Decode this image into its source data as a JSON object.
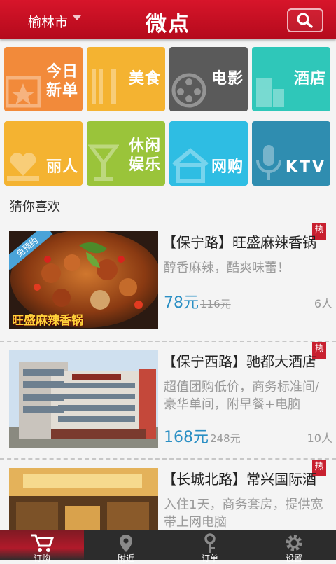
{
  "header": {
    "city": "榆林市",
    "title": "微点"
  },
  "tiles": [
    {
      "label_line1": "今日",
      "label_line2": "新单",
      "color": "#f28a3a",
      "icon": "star-icon"
    },
    {
      "label_line1": "美食",
      "label_line2": "",
      "color": "#f4b331",
      "icon": "fork-knife-icon"
    },
    {
      "label_line1": "电影",
      "label_line2": "",
      "color": "#5a5a5a",
      "icon": "film-reel-icon"
    },
    {
      "label_line1": "酒店",
      "label_line2": "",
      "color": "#2fc7b9",
      "icon": "building-icon"
    },
    {
      "label_line1": "丽人",
      "label_line2": "",
      "color": "#f4b331",
      "icon": "heart-hand-icon"
    },
    {
      "label_line1": "休闲",
      "label_line2": "娱乐",
      "color": "#9ac43a",
      "icon": "glass-icon"
    },
    {
      "label_line1": "网购",
      "label_line2": "",
      "color": "#2ebde3",
      "icon": "house-icon"
    },
    {
      "label_line1": "KTV",
      "label_line2": "",
      "color": "#2f8db0",
      "icon": "microphone-icon"
    }
  ],
  "section_title": "猜你喜欢",
  "deals": [
    {
      "title": "【保宁路】旺盛麻辣香锅",
      "desc": "醇香麻辣，酷爽味蕾！",
      "price": "78元",
      "orig_price": "116元",
      "count": "6人",
      "hot": "热",
      "badge": "免预约",
      "img_caption": "旺盛麻辣香锅"
    },
    {
      "title": "【保宁西路】驰都大酒店",
      "desc": "超值团购低价，商务标准间/豪华单间，附早餐+电脑",
      "price": "168元",
      "orig_price": "248元",
      "count": "10人",
      "hot": "热"
    },
    {
      "title": "【长城北路】常兴国际酒",
      "desc": "入住1天，商务套房，提供宽带上网电脑",
      "price": "",
      "orig_price": "",
      "count": "",
      "hot": "热"
    }
  ],
  "nav": [
    {
      "label": "订购",
      "icon": "cart-icon"
    },
    {
      "label": "附近",
      "icon": "location-pin-icon"
    },
    {
      "label": "订单",
      "icon": "key-icon"
    },
    {
      "label": "设置",
      "icon": "gear-icon"
    }
  ],
  "colors": {
    "header_red": "#c8102e",
    "price_blue": "#2a8fc4",
    "hot_red": "#c8202f"
  }
}
